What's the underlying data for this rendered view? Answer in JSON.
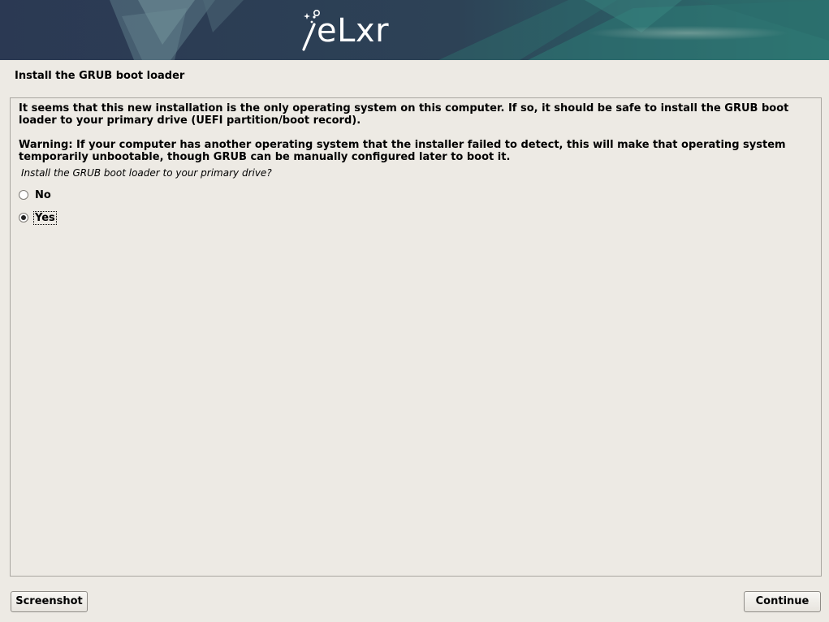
{
  "header": {
    "logo_text": "eLxr",
    "icon": "magic-wand-icon",
    "colors": {
      "banner_dark": "#2c3c55",
      "banner_teal": "#2f7d78"
    }
  },
  "page": {
    "title": "Install the GRUB boot loader",
    "description_1": "It seems that this new installation is the only operating system on this computer. If so, it should be safe to install the GRUB boot loader to your primary drive (UEFI partition/boot record).",
    "description_2": "Warning: If your computer has another operating system that the installer failed to detect, this will make that operating system temporarily unbootable, though GRUB can be manually configured later to boot it.",
    "question": "Install the GRUB boot loader to your primary drive?",
    "options": [
      {
        "label": "No",
        "selected": false
      },
      {
        "label": "Yes",
        "selected": true
      }
    ]
  },
  "buttons": {
    "screenshot_label": "Screenshot",
    "continue_label": "Continue"
  },
  "colors": {
    "background": "#edeae4",
    "frame_border": "#a9a6a0"
  }
}
